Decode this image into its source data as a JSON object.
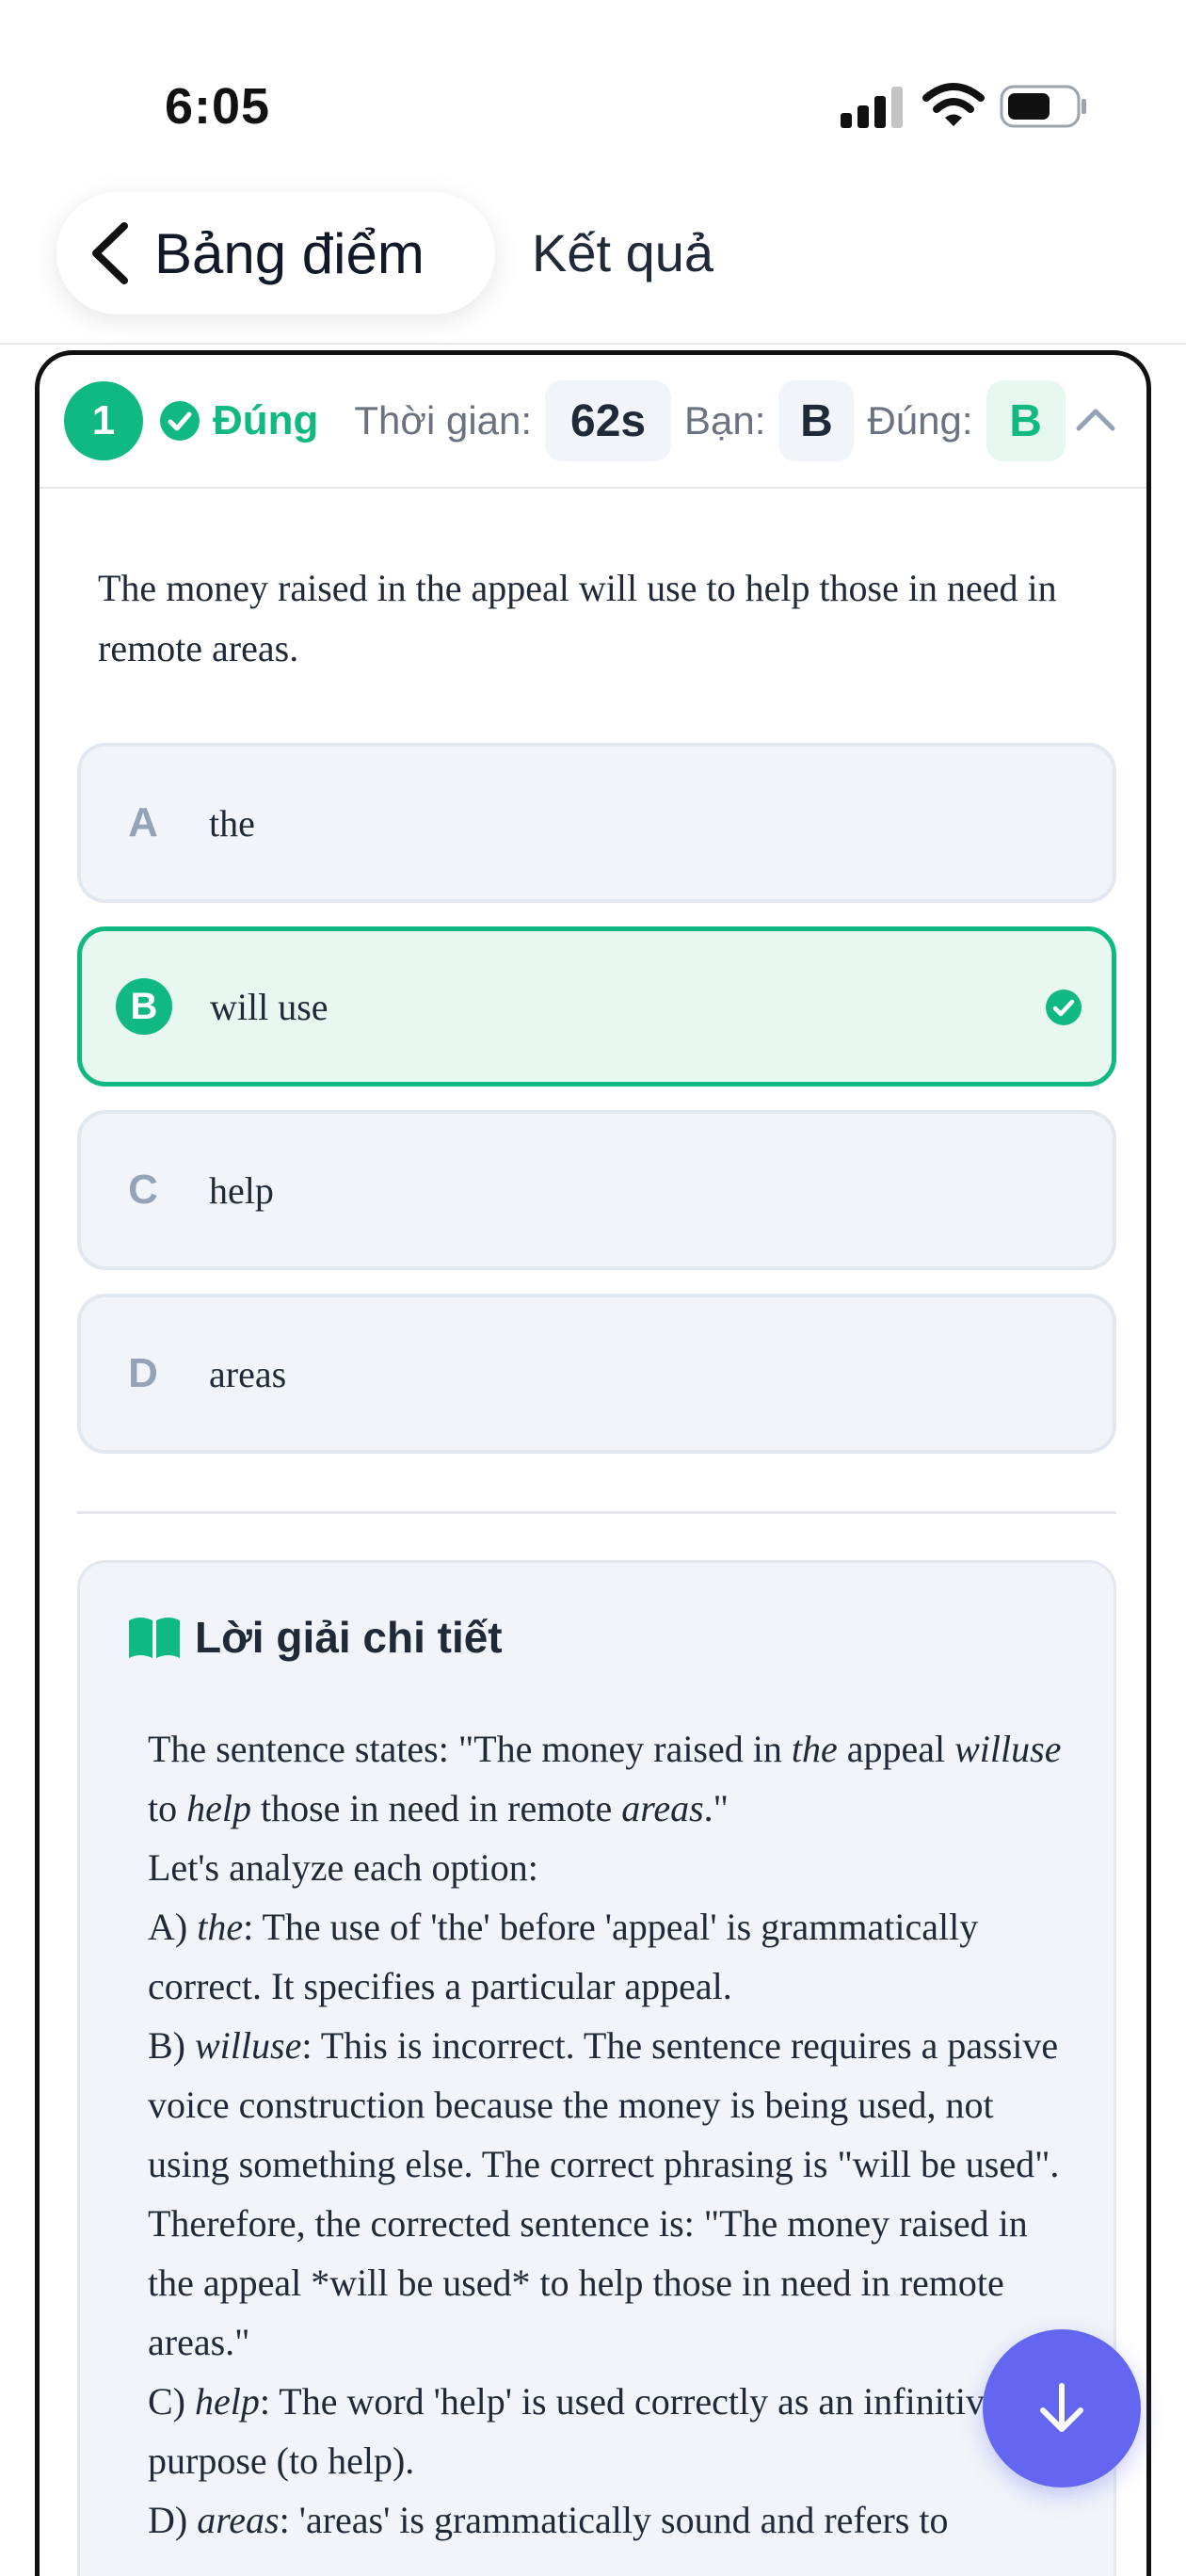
{
  "status_bar": {
    "time": "6:05"
  },
  "header": {
    "back_label": "Bảng điểm",
    "title": "Kết quả"
  },
  "question_card": {
    "number": "1",
    "status_label": "Đúng",
    "time_label": "Thời gian:",
    "time_value": "62s",
    "your_answer_label": "Bạn:",
    "your_answer": "B",
    "correct_answer_label": "Đúng:",
    "correct_answer": "B",
    "question_text": "The money raised in the appeal will use to help those in need in remote areas.",
    "options": [
      {
        "letter": "A",
        "text": "the"
      },
      {
        "letter": "B",
        "text": "will use"
      },
      {
        "letter": "C",
        "text": "help"
      },
      {
        "letter": "D",
        "text": "areas"
      }
    ],
    "correct_index": 1
  },
  "solution": {
    "title": "Lời giải chi tiết",
    "l1a": "The sentence states: \"The money raised in ",
    "l1b": "the",
    "l1c": " appeal ",
    "l1d": "willuse",
    "l1e": " to ",
    "l1f": "help",
    "l1g": " those in need in remote ",
    "l1h": "areas",
    "l1i": ".\"",
    "l2": "Let's analyze each option:",
    "a_prefix": "A) ",
    "a_math": "the",
    "a_text": ": The use of 'the' before 'appeal' is grammatically correct. It specifies a particular appeal.",
    "b_prefix": "B) ",
    "b_math": "willuse",
    "b_text": ": This is incorrect. The sentence requires a passive voice construction because the money is being used, not using something else. The correct phrasing is \"will be used\".",
    "therefore": "Therefore, the corrected sentence is: \"The money raised in the appeal *will be used* to help those in need in remote areas.\"",
    "c_prefix": "C) ",
    "c_math": "help",
    "c_text": ": The word 'help' is used correctly as an infinitive of purpose (to help).",
    "d_prefix": "D) ",
    "d_math": "areas",
    "d_text": ": 'areas' is grammatically sound and refers to"
  },
  "colors": {
    "correct": "#10b981",
    "fab": "#6366f1",
    "option_bg": "#f1f5f9"
  }
}
